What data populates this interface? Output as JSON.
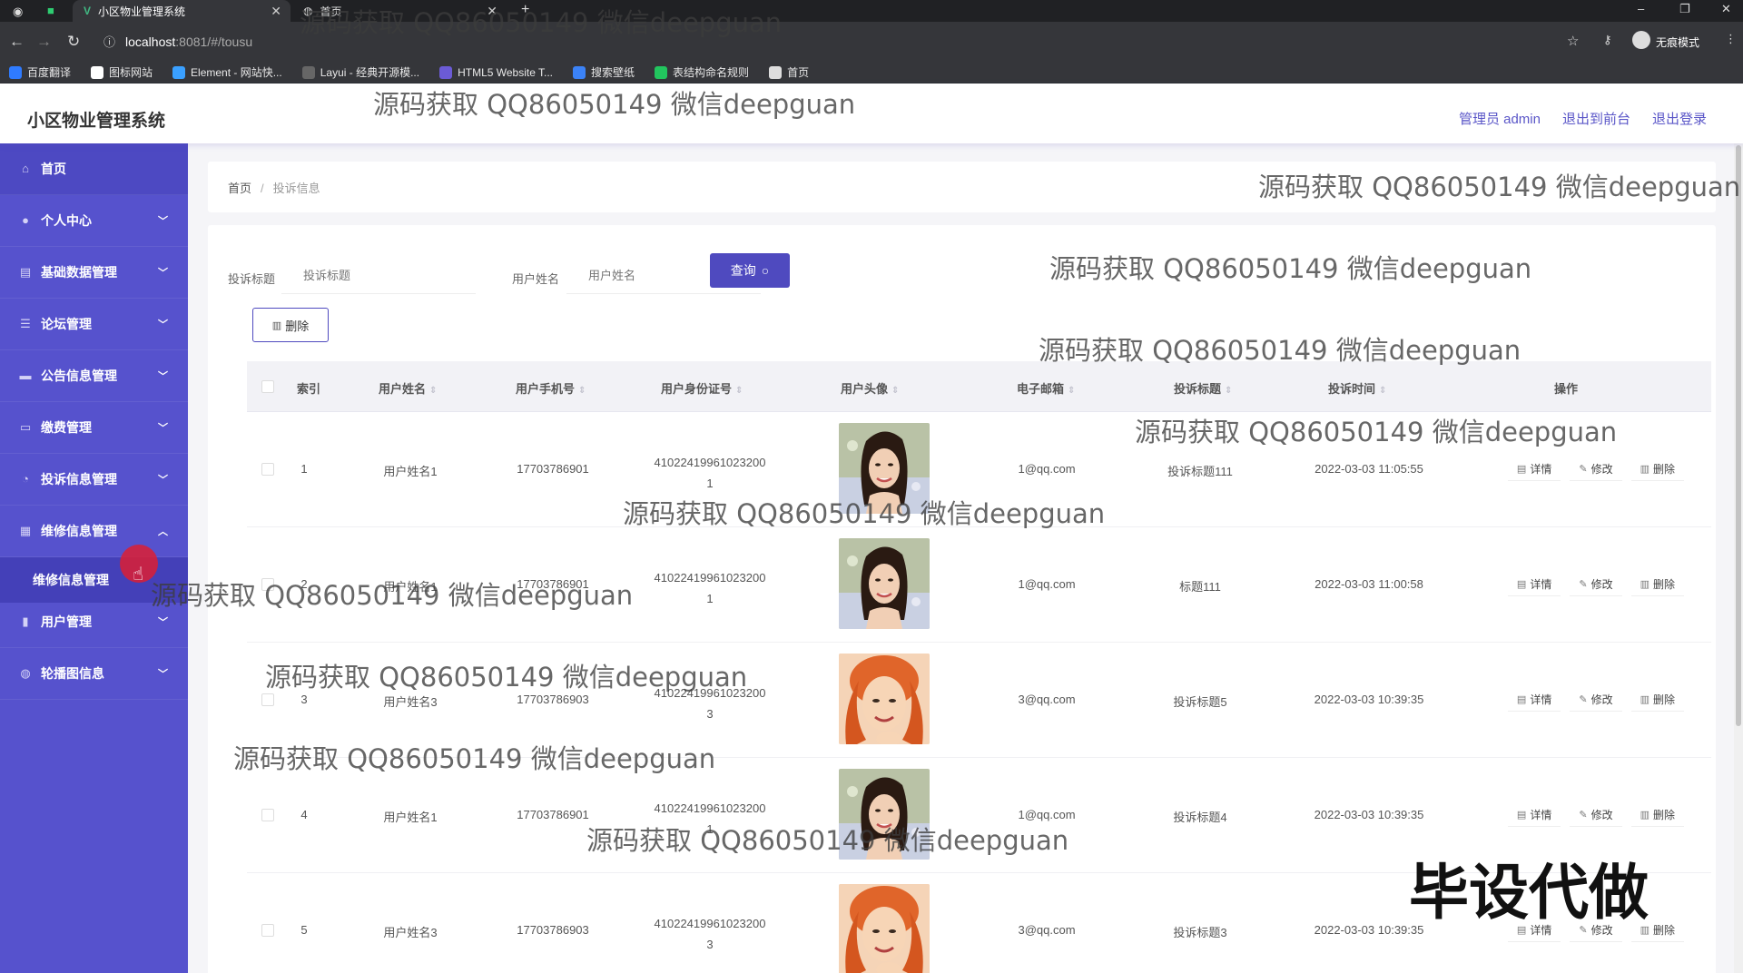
{
  "browser": {
    "tabs": [
      {
        "title": "小区物业管理系统",
        "active": true
      },
      {
        "title": "首页",
        "active": false
      }
    ],
    "url_host": "localhost",
    "url_rest": ":8081/#/tousu",
    "incognito_label": "无痕模式",
    "bookmarks": [
      {
        "label": "百度翻译",
        "color": "#2f7bff"
      },
      {
        "label": "图标网站",
        "color": "#ffffff"
      },
      {
        "label": "Element - 网站快...",
        "color": "#3aa0ff"
      },
      {
        "label": "Layui - 经典开源模...",
        "color": "#666666"
      },
      {
        "label": "HTML5 Website T...",
        "color": "#6b5bd6"
      },
      {
        "label": "搜索壁纸",
        "color": "#3b82f6"
      },
      {
        "label": "表结构命名规则",
        "color": "#22c55e"
      },
      {
        "label": "首页",
        "color": "#dddddd"
      }
    ]
  },
  "header": {
    "title": "小区物业管理系统",
    "user": "管理员 admin",
    "to_front": "退出到前台",
    "logout": "退出登录"
  },
  "sidebar": {
    "items": [
      {
        "label": "首页",
        "icon": "home-icon"
      },
      {
        "label": "个人中心",
        "icon": "user-icon"
      },
      {
        "label": "基础数据管理",
        "icon": "database-icon"
      },
      {
        "label": "论坛管理",
        "icon": "forum-icon"
      },
      {
        "label": "公告信息管理",
        "icon": "notice-icon"
      },
      {
        "label": "缴费管理",
        "icon": "payment-icon"
      },
      {
        "label": "投诉信息管理",
        "icon": "complaint-icon"
      },
      {
        "label": "维修信息管理",
        "icon": "repair-icon"
      },
      {
        "label": "用户管理",
        "icon": "chart-icon"
      },
      {
        "label": "轮播图信息",
        "icon": "carousel-icon"
      }
    ],
    "sub_item": "维修信息管理"
  },
  "breadcrumb": {
    "home": "首页",
    "current": "投诉信息"
  },
  "search": {
    "title_label": "投诉标题",
    "title_placeholder": "投诉标题",
    "name_label": "用户姓名",
    "name_placeholder": "用户姓名",
    "query_button": "查询",
    "delete_button": "删除"
  },
  "table": {
    "columns": [
      "索引",
      "用户姓名",
      "用户手机号",
      "用户身份证号",
      "用户头像",
      "电子邮箱",
      "投诉标题",
      "投诉时间",
      "操作"
    ],
    "actions": {
      "detail": "详情",
      "edit": "修改",
      "delete": "删除"
    },
    "rows": [
      {
        "index": "1",
        "name": "用户姓名1",
        "phone": "17703786901",
        "id_a": "41022419961023200",
        "id_b": "1",
        "avatar": "woman-1",
        "email": "1@qq.com",
        "title": "投诉标题111",
        "time": "2022-03-03 11:05:55"
      },
      {
        "index": "2",
        "name": "用户姓名1",
        "phone": "17703786901",
        "id_a": "41022419961023200",
        "id_b": "1",
        "avatar": "woman-1",
        "email": "1@qq.com",
        "title": "标题111",
        "time": "2022-03-03 11:00:58"
      },
      {
        "index": "3",
        "name": "用户姓名3",
        "phone": "17703786903",
        "id_a": "41022419961023200",
        "id_b": "3",
        "avatar": "woman-2",
        "email": "3@qq.com",
        "title": "投诉标题5",
        "time": "2022-03-03 10:39:35"
      },
      {
        "index": "4",
        "name": "用户姓名1",
        "phone": "17703786901",
        "id_a": "41022419961023200",
        "id_b": "1",
        "avatar": "woman-1",
        "email": "1@qq.com",
        "title": "投诉标题4",
        "time": "2022-03-03 10:39:35"
      },
      {
        "index": "5",
        "name": "用户姓名3",
        "phone": "17703786903",
        "id_a": "41022419961023200",
        "id_b": "3",
        "avatar": "woman-2",
        "email": "3@qq.com",
        "title": "投诉标题3",
        "time": "2022-03-03 10:39:35"
      }
    ]
  },
  "watermark": {
    "text": "源码获取 QQ86050149 微信deepguan",
    "big_text": "毕设代做"
  },
  "colors": {
    "accent": "#5652cd",
    "button": "#4f4abf"
  }
}
